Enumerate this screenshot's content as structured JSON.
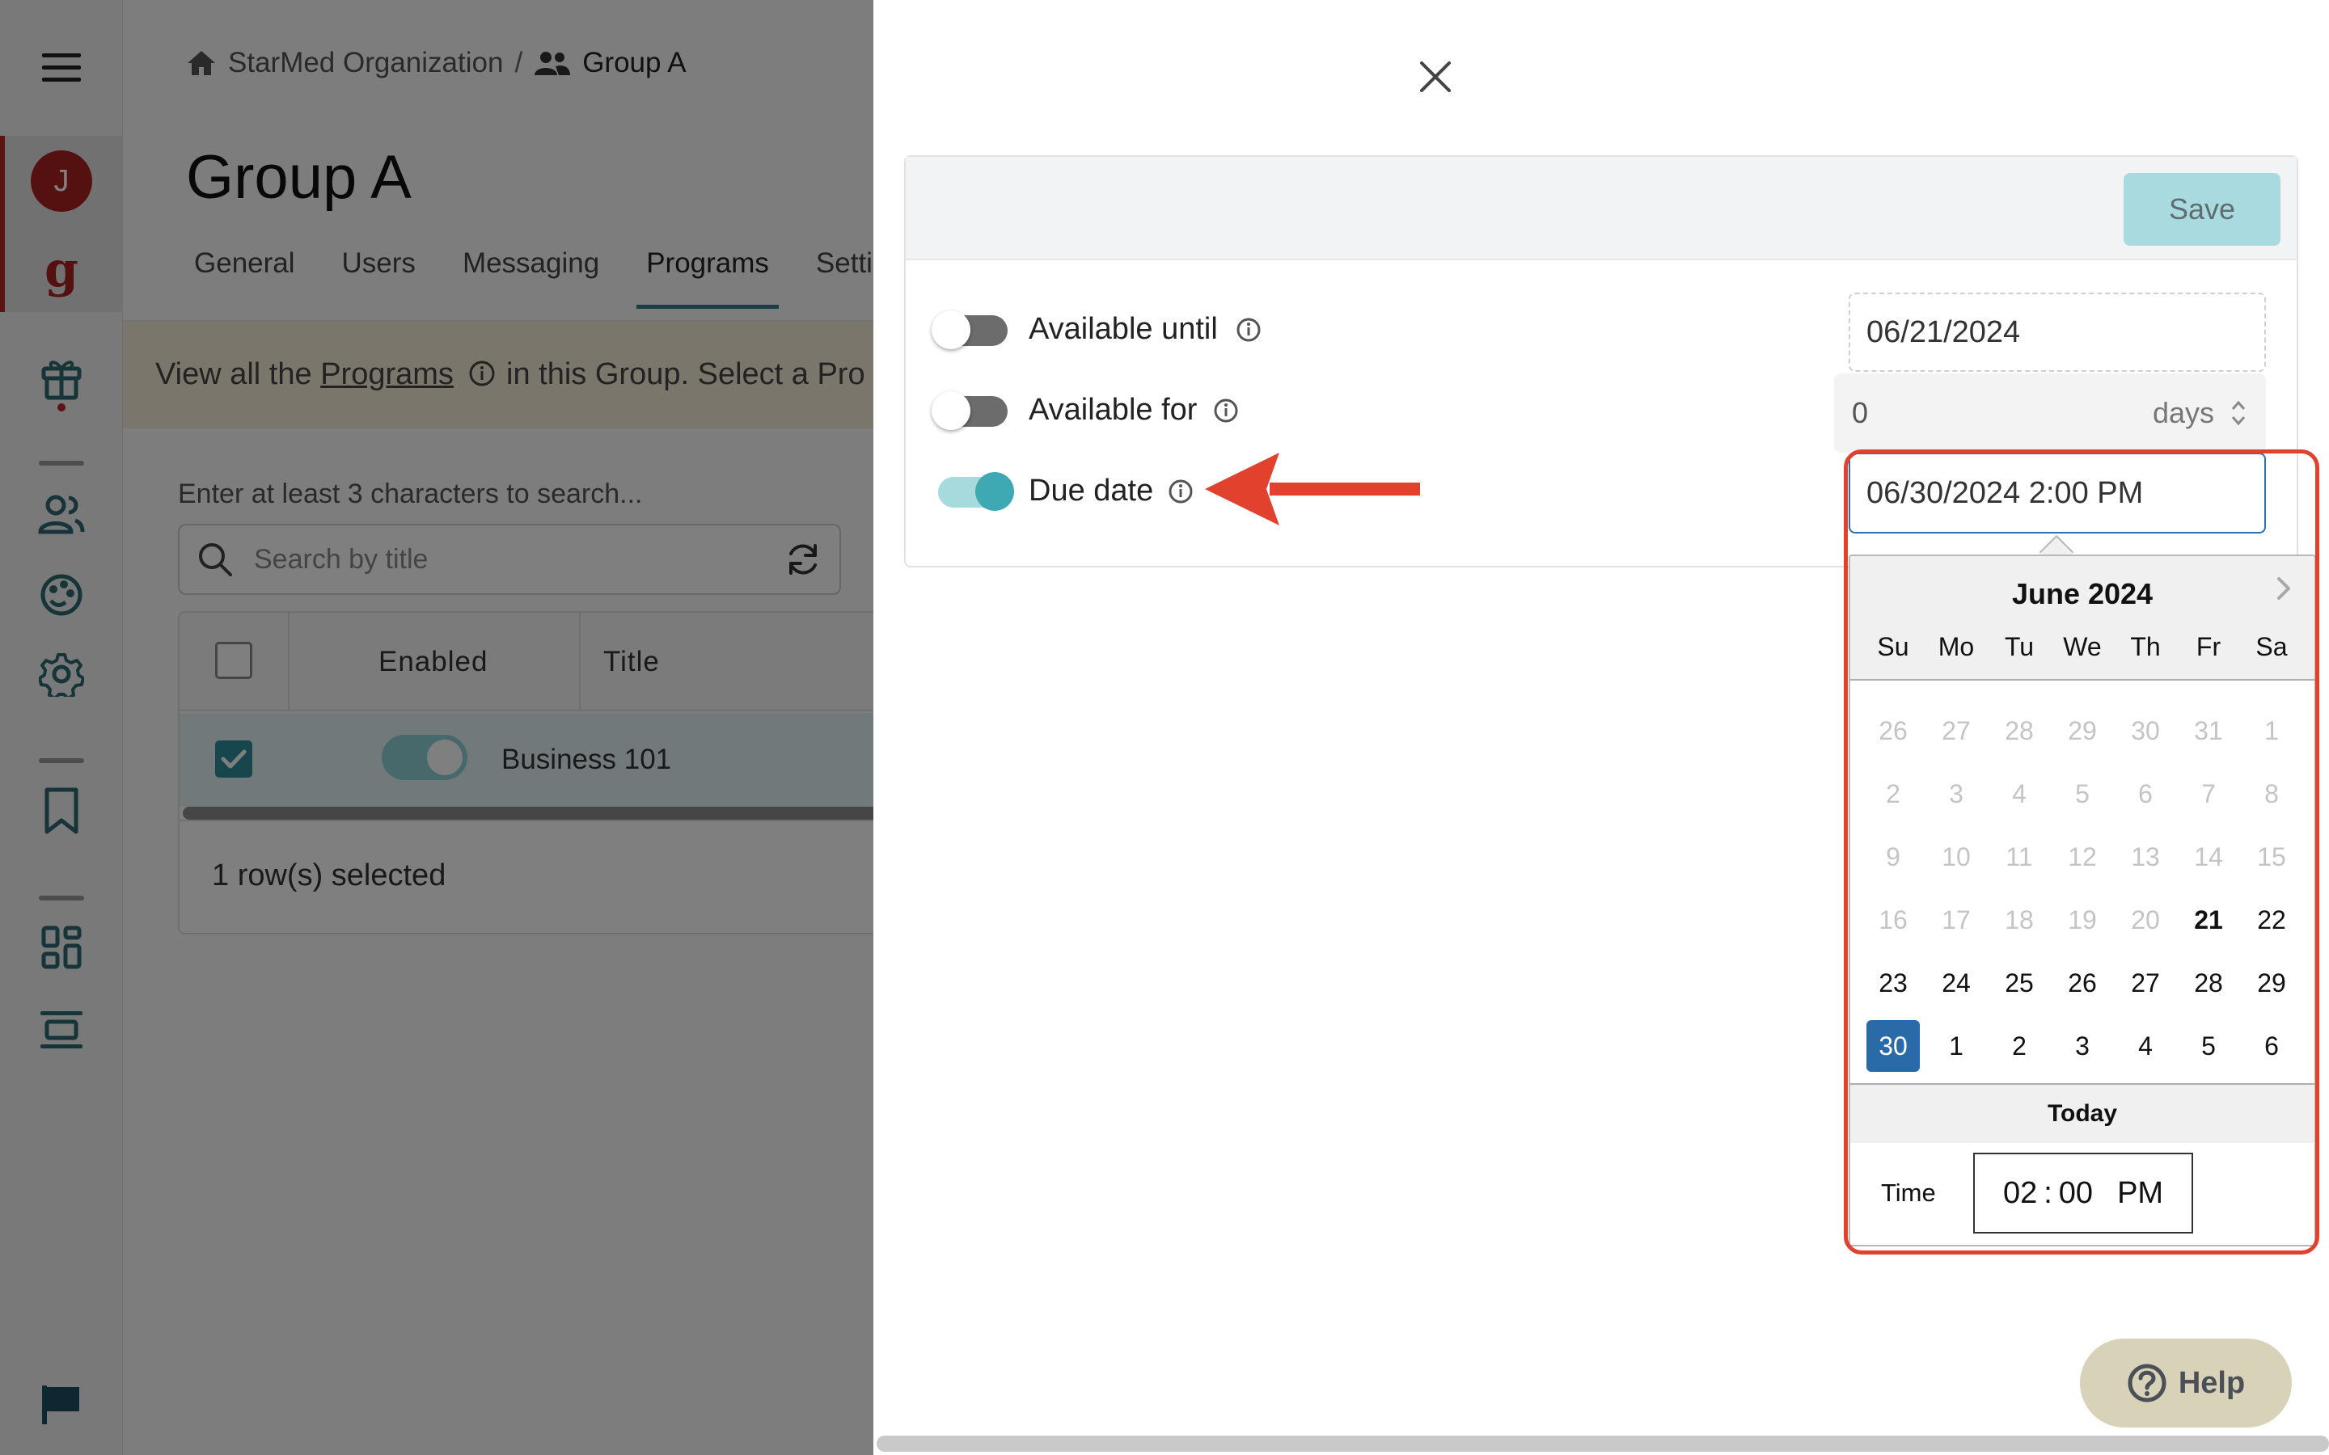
{
  "breadcrumb": {
    "org": "StarMed Organization",
    "separator": "/",
    "group": "Group A"
  },
  "page": {
    "title": "Group A"
  },
  "tabs": [
    {
      "label": "General"
    },
    {
      "label": "Users"
    },
    {
      "label": "Messaging"
    },
    {
      "label": "Programs",
      "active": true
    },
    {
      "label": "Settin"
    }
  ],
  "banner": {
    "prefix": "View all the ",
    "link": "Programs",
    "suffix": " in this Group. Select a Pro"
  },
  "search": {
    "hint": "Enter at least 3 characters to search...",
    "placeholder": "Search by title"
  },
  "table": {
    "columns": [
      "Enabled",
      "Title"
    ],
    "rows": [
      {
        "selected": true,
        "enabled": true,
        "title": "Business 101"
      }
    ],
    "footer": "1 row(s) selected"
  },
  "user": {
    "initial": "J"
  },
  "brand": {
    "mark": "g",
    "accent": "#a9231f"
  },
  "drawer": {
    "save_label": "Save",
    "options": [
      {
        "label": "Available until",
        "on": false,
        "value": "06/21/2024"
      },
      {
        "label": "Available for",
        "on": false,
        "value": "0",
        "unit": "days"
      },
      {
        "label": "Due date",
        "on": true,
        "value": "06/30/2024 2:00 PM"
      }
    ]
  },
  "picker": {
    "month": "June 2024",
    "weekdays": [
      "Su",
      "Mo",
      "Tu",
      "We",
      "Th",
      "Fr",
      "Sa"
    ],
    "weeks": [
      [
        "26",
        "27",
        "28",
        "29",
        "30",
        "31",
        "1"
      ],
      [
        "2",
        "3",
        "4",
        "5",
        "6",
        "7",
        "8"
      ],
      [
        "9",
        "10",
        "11",
        "12",
        "13",
        "14",
        "15"
      ],
      [
        "16",
        "17",
        "18",
        "19",
        "20",
        "21",
        "22"
      ],
      [
        "23",
        "24",
        "25",
        "26",
        "27",
        "28",
        "29"
      ],
      [
        "30",
        "1",
        "2",
        "3",
        "4",
        "5",
        "6"
      ]
    ],
    "selected": "30",
    "today": "21",
    "today_label": "Today",
    "time_label": "Time",
    "time": {
      "hour": "02",
      "sep": ":",
      "minute": "00",
      "ampm": "PM"
    }
  },
  "help": {
    "label": "Help"
  },
  "colors": {
    "teal": "#2e7f88",
    "annotation": "#e2412d",
    "selected_day": "#2a6aa8"
  }
}
